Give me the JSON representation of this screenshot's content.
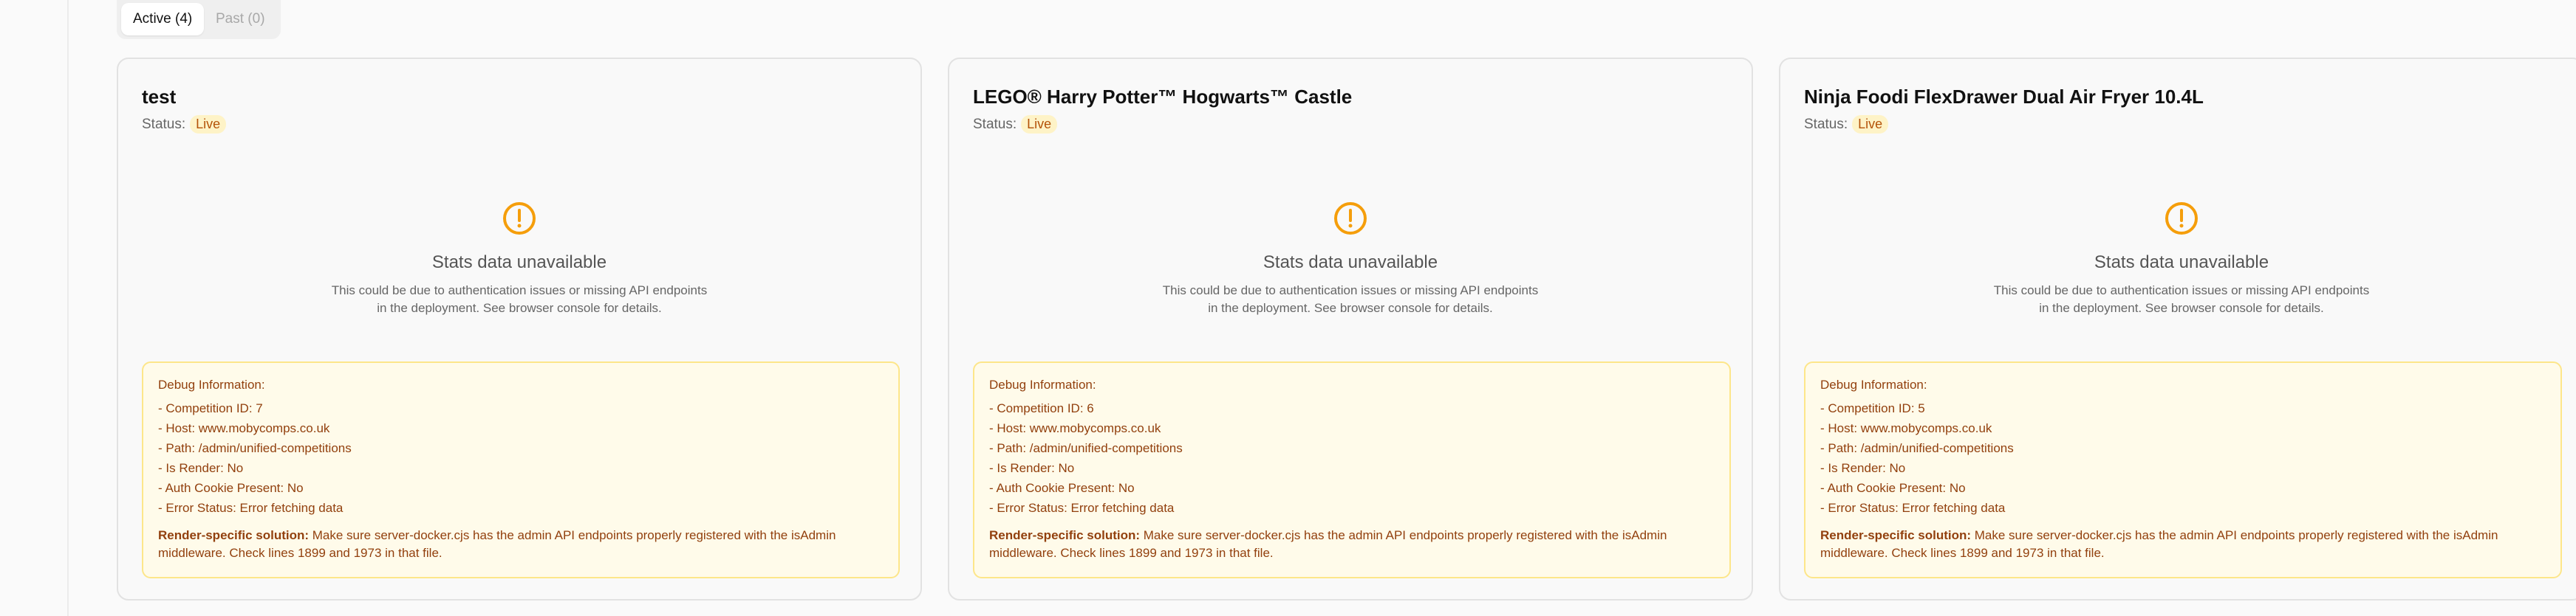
{
  "tabs": [
    {
      "label": "Active (4)"
    },
    {
      "label": "Past (0)"
    }
  ],
  "colors": {
    "accent": "#f59e0b",
    "badge_bg": "#fef3c7",
    "debug_text": "#92400e"
  },
  "cards": [
    {
      "title": "test",
      "status_label": "Status:",
      "status": "Live",
      "unavailable": "Stats data unavailable",
      "desc1": "This could be due to authentication issues or missing API endpoints",
      "desc2": "in the deployment. See browser console for details.",
      "debug_title": "Debug Information:",
      "debug_lines": [
        "- Competition ID: 7",
        "- Host: www.mobycomps.co.uk",
        "- Path: /admin/unified-competitions",
        "- Is Render: No",
        "- Auth Cookie Present: No",
        "- Error Status: Error fetching data"
      ],
      "solution_label": "Render-specific solution:",
      "solution_text": " Make sure server-docker.cjs has the admin API endpoints properly registered with the isAdmin middleware. Check lines 1899 and 1973 in that file."
    },
    {
      "title": "LEGO® Harry Potter™ Hogwarts™ Castle",
      "status_label": "Status:",
      "status": "Live",
      "unavailable": "Stats data unavailable",
      "desc1": "This could be due to authentication issues or missing API endpoints",
      "desc2": "in the deployment. See browser console for details.",
      "debug_title": "Debug Information:",
      "debug_lines": [
        "- Competition ID: 6",
        "- Host: www.mobycomps.co.uk",
        "- Path: /admin/unified-competitions",
        "- Is Render: No",
        "- Auth Cookie Present: No",
        "- Error Status: Error fetching data"
      ],
      "solution_label": "Render-specific solution:",
      "solution_text": " Make sure server-docker.cjs has the admin API endpoints properly registered with the isAdmin middleware. Check lines 1899 and 1973 in that file."
    },
    {
      "title": "Ninja Foodi FlexDrawer Dual Air Fryer 10.4L",
      "status_label": "Status:",
      "status": "Live",
      "unavailable": "Stats data unavailable",
      "desc1": "This could be due to authentication issues or missing API endpoints",
      "desc2": "in the deployment. See browser console for details.",
      "debug_title": "Debug Information:",
      "debug_lines": [
        "- Competition ID: 5",
        "- Host: www.mobycomps.co.uk",
        "- Path: /admin/unified-competitions",
        "- Is Render: No",
        "- Auth Cookie Present: No",
        "- Error Status: Error fetching data"
      ],
      "solution_label": "Render-specific solution:",
      "solution_text": " Make sure server-docker.cjs has the admin API endpoints properly registered with the isAdmin middleware. Check lines 1899 and 1973 in that file."
    }
  ]
}
